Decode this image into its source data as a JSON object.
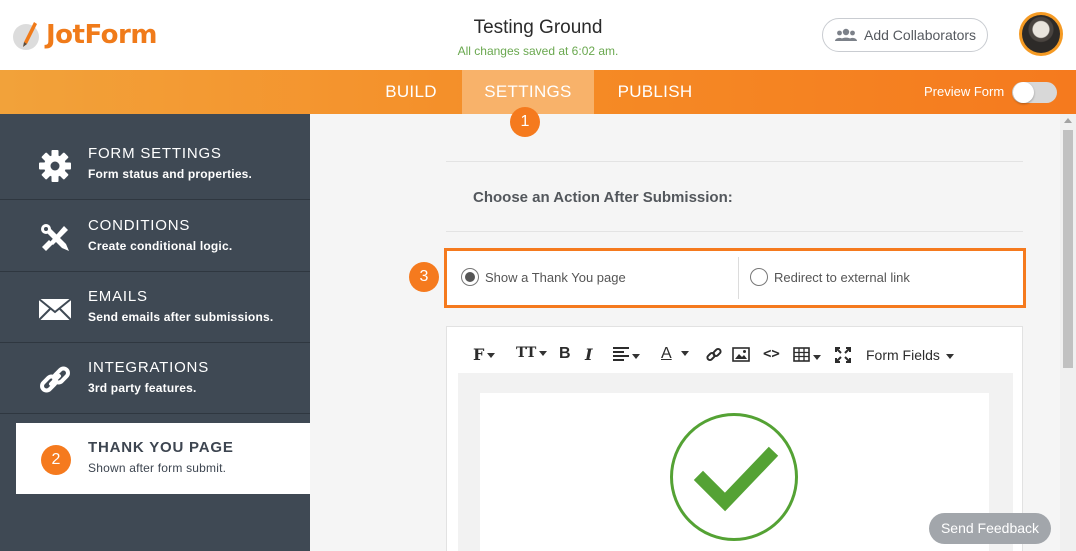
{
  "app": {
    "logo_text": "JotForm",
    "form_title": "Testing Ground",
    "save_status": "All changes saved at 6:02 am.",
    "collaborators_label": "Add Collaborators",
    "avatar_icon": "user-avatar-icon"
  },
  "nav": {
    "tabs": [
      {
        "label": "BUILD",
        "active": false
      },
      {
        "label": "SETTINGS",
        "active": true
      },
      {
        "label": "PUBLISH",
        "active": false
      }
    ],
    "preview_label": "Preview Form",
    "preview_enabled": false
  },
  "markers": [
    "1",
    "2",
    "3"
  ],
  "sidebar": {
    "items": [
      {
        "title": "FORM SETTINGS",
        "subtitle": "Form status and properties.",
        "icon": "gear-icon"
      },
      {
        "title": "CONDITIONS",
        "subtitle": "Create conditional logic.",
        "icon": "tools-icon"
      },
      {
        "title": "EMAILS",
        "subtitle": "Send emails after submissions.",
        "icon": "envelope-icon"
      },
      {
        "title": "INTEGRATIONS",
        "subtitle": "3rd party features.",
        "icon": "link-icon"
      },
      {
        "title": "THANK YOU PAGE",
        "subtitle": "Shown after form submit.",
        "icon": "badge-icon",
        "active": true
      }
    ]
  },
  "main": {
    "section_title": "Choose an Action After Submission:",
    "options": [
      {
        "label": "Show a Thank You page",
        "selected": true
      },
      {
        "label": "Redirect to external link",
        "selected": false
      }
    ],
    "toolbar": {
      "font_label": "F",
      "size_label": "TT",
      "bold_label": "B",
      "italic_label": "I",
      "color_label": "A",
      "code_label": "<>",
      "form_fields_label": "Form Fields"
    }
  },
  "feedback_label": "Send Feedback",
  "colors": {
    "accent": "#f57a1e",
    "sidebar": "#3f4954",
    "success": "#54a234"
  }
}
